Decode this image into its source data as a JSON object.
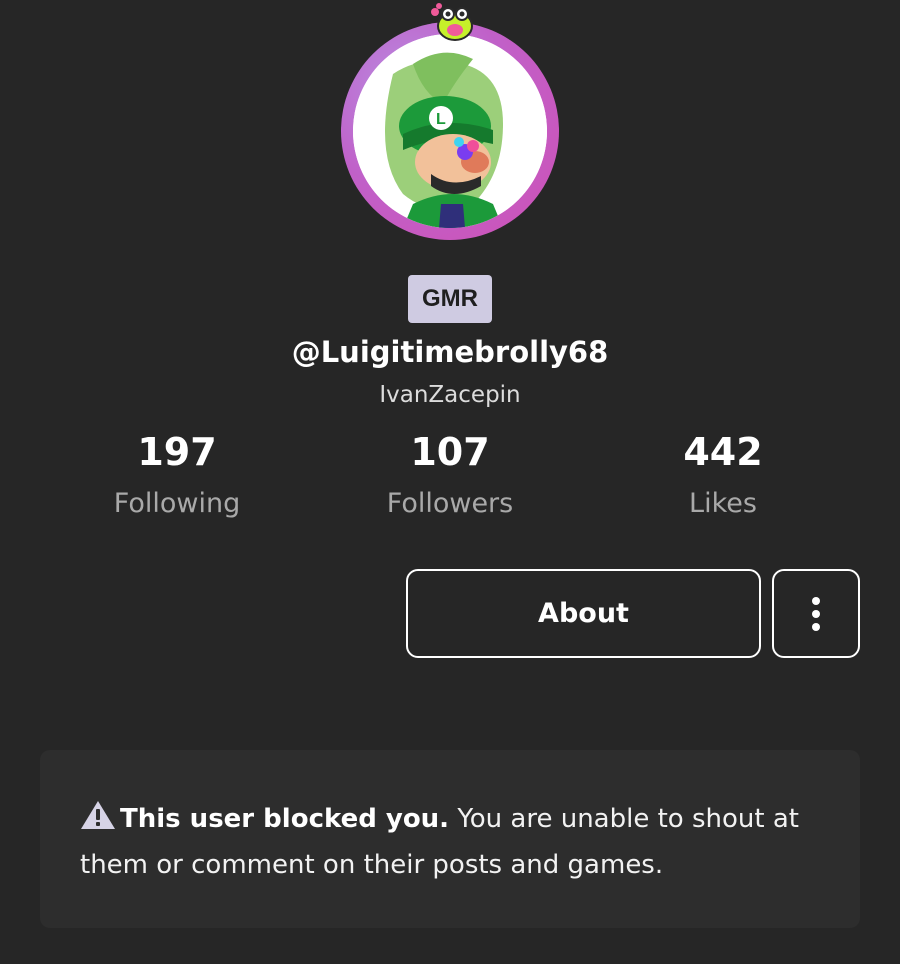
{
  "profile": {
    "tag": "GMR",
    "username": "@Luigitimebrolly68",
    "display_name": "IvanZacepin"
  },
  "stats": [
    {
      "value": "197",
      "label": "Following"
    },
    {
      "value": "107",
      "label": "Followers"
    },
    {
      "value": "442",
      "label": "Likes"
    }
  ],
  "actions": {
    "about_label": "About"
  },
  "notice": {
    "bold": "This user blocked you.",
    "text": " You are unable to shout at them or comment on their posts and games."
  },
  "colors": {
    "background": "#262626",
    "tag_bg": "#cfcbe2",
    "avatar_ring": "#c061c9",
    "muted_text": "#a9a9a9"
  },
  "icons": {
    "avatar_badge": "frog-badge-icon",
    "more": "more-vertical-icon",
    "warning": "warning-triangle-icon"
  }
}
